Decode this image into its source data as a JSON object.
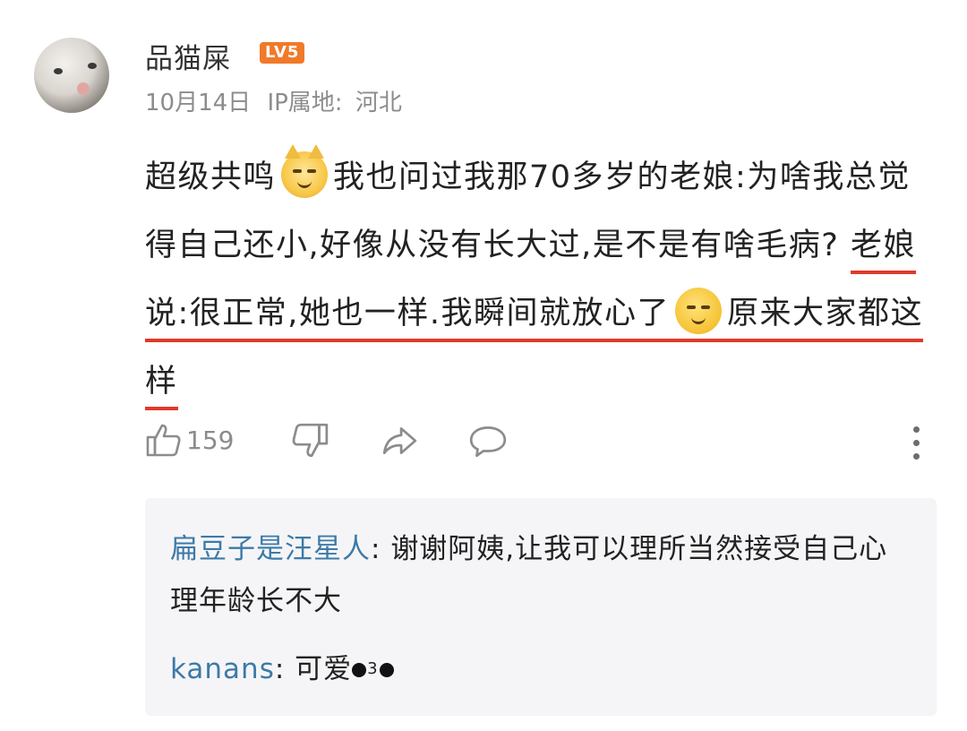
{
  "post": {
    "username": "品猫屎",
    "level": "LV5",
    "date": "10月14日",
    "location_label": "IP属地:",
    "location": "河北",
    "text_part1": "超级共鸣",
    "text_part2": "我也问过我那70多岁的老娘:为啥我总觉得自己还小,好像从没有长大过,是不是有啥毛病?",
    "text_highlight1": "老娘说:很正常,她也一样.我瞬间就放心了",
    "text_highlight2": "原来大家都这样",
    "like_count": "159"
  },
  "icons": [
    "avatar",
    "cat-emoji-icon",
    "smug-emoji-icon",
    "thumbs-up-icon",
    "thumbs-down-icon",
    "share-icon",
    "comment-icon",
    "more-icon"
  ],
  "replies": [
    {
      "name": "扁豆子是汪星人",
      "sep": ": ",
      "text": "谢谢阿姨,让我可以理所当然接受自己心理年龄长不大"
    },
    {
      "name": "kanans",
      "sep": ": ",
      "text": "可爱",
      "suffix": "3"
    }
  ],
  "colors": {
    "accent": "#e0392b",
    "reply_name": "#3d7aa8",
    "level_badge": "#f07a2a",
    "meta": "#8c8c8c"
  }
}
